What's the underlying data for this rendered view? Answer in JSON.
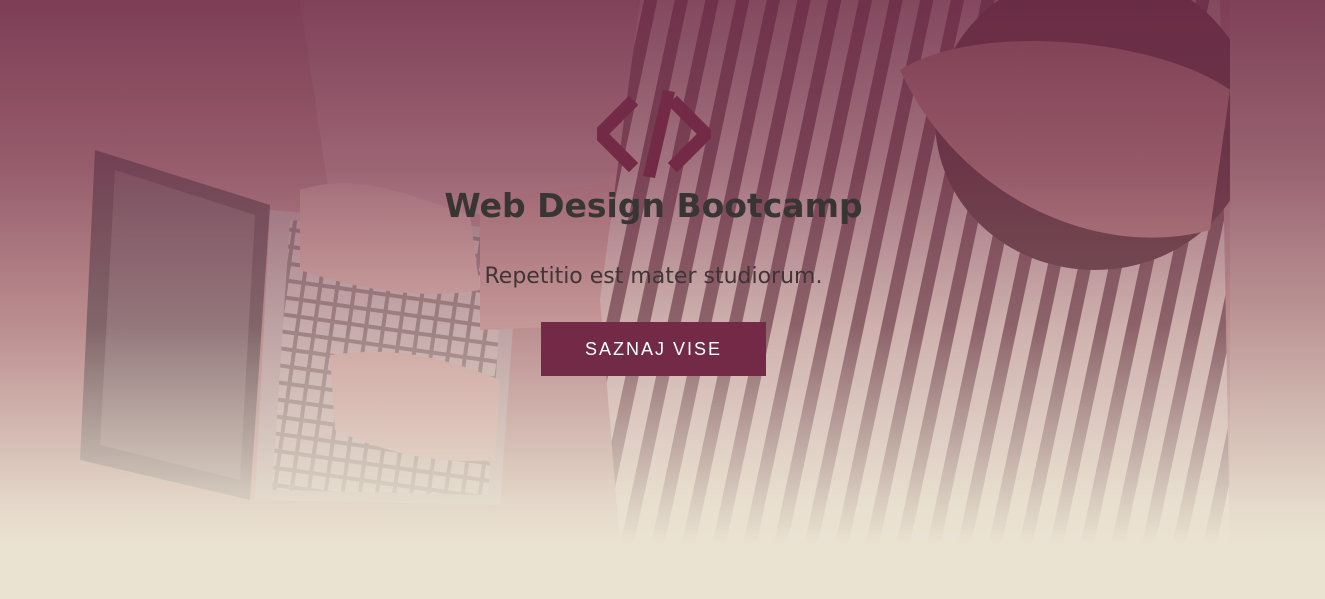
{
  "hero": {
    "logo_icon": "code-brackets-icon",
    "title": "Web Design Bootcamp",
    "subtitle": "Repetitio est mater studiorum.",
    "cta_label": "SAZNAJ VISE",
    "background_image": "person-typing-on-laptop-photo"
  },
  "colors": {
    "accent": "#722a46",
    "title_text": "#3a3535",
    "page_bottom": "#ebe3d2"
  }
}
